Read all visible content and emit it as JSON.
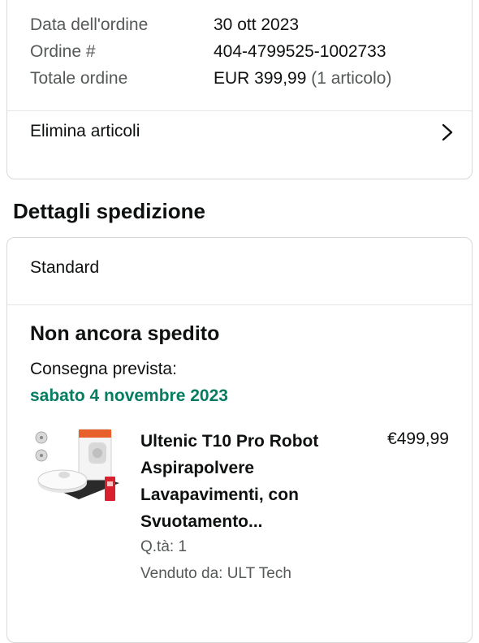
{
  "order_summary": {
    "rows": [
      {
        "label": "Data dell'ordine",
        "value": "30 ott 2023",
        "extra": ""
      },
      {
        "label": "Ordine #",
        "value": "404-4799525-1002733",
        "extra": ""
      },
      {
        "label": "Totale ordine",
        "value": "EUR 399,99",
        "extra": " (1 articolo)"
      }
    ],
    "delete_items_label": "Elimina articoli",
    "chevron_icon": "chevron-right-icon"
  },
  "shipping": {
    "section_title": "Dettagli spedizione",
    "method": "Standard",
    "status": "Non ancora spedito",
    "delivery_label": "Consegna prevista:",
    "delivery_date": "sabato 4 novembre 2023",
    "delivery_color": "#067d62",
    "product": {
      "title": "Ultenic T10 Pro Robot Aspirapolvere Lavapavimenti, con Svuotamento...",
      "price": "€499,99",
      "quantity": "Q.tà: 1",
      "seller": "Venduto da: ULT Tech",
      "image_icon": "robot-vacuum-image"
    }
  }
}
